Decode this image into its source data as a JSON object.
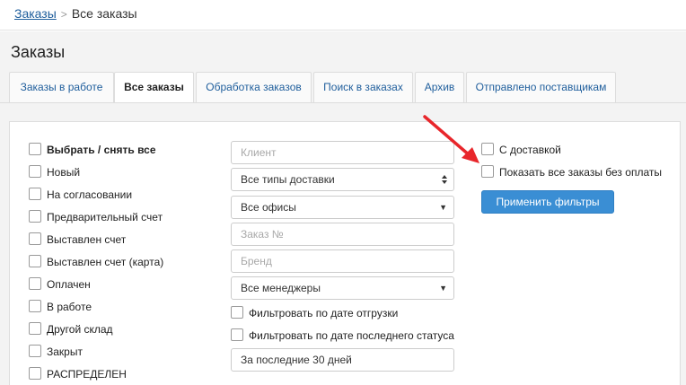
{
  "breadcrumb": {
    "link": "Заказы",
    "separator": ">",
    "current": "Все заказы"
  },
  "page_title": "Заказы",
  "tabs": [
    {
      "label": "Заказы в работе"
    },
    {
      "label": "Все заказы"
    },
    {
      "label": "Обработка заказов"
    },
    {
      "label": "Поиск в заказах"
    },
    {
      "label": "Архив"
    },
    {
      "label": "Отправлено поставщикам"
    }
  ],
  "active_tab": "Все заказы",
  "statuses": {
    "select_all": "Выбрать / снять все",
    "items": [
      "Новый",
      "На согласовании",
      "Предварительный счет",
      "Выставлен счет",
      "Выставлен счет (карта)",
      "Оплачен",
      "В работе",
      "Другой склад",
      "Закрыт",
      "РАСПРЕДЕЛЕН"
    ]
  },
  "filters": {
    "client_placeholder": "Клиент",
    "delivery_type": "Все типы доставки",
    "office": "Все офисы",
    "order_placeholder": "Заказ №",
    "brand_placeholder": "Бренд",
    "manager": "Все менеджеры",
    "by_shipment_date": "Фильтровать по дате отгрузки",
    "by_last_status_date": "Фильтровать по дате последнего статуса",
    "period": "За последние 30 дней"
  },
  "options": {
    "with_delivery": "С доставкой",
    "show_unpaid": "Показать все заказы без оплаты",
    "apply_button": "Применить фильтры"
  },
  "colors": {
    "accent": "#3a8ed4",
    "link": "#1f5e9c",
    "annotation_arrow": "#e8262b"
  }
}
